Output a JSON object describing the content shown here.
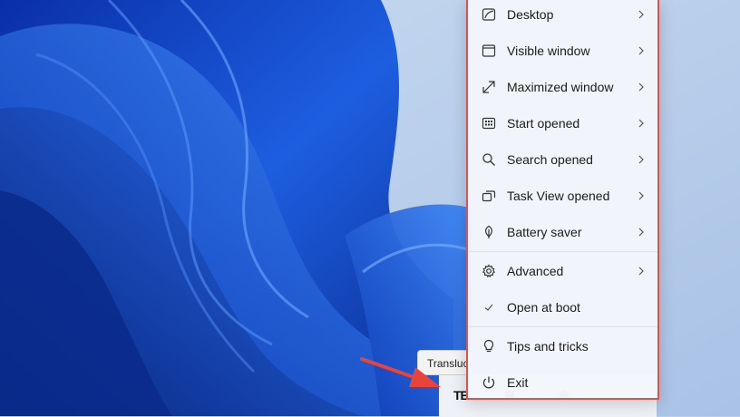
{
  "menu": {
    "items": [
      {
        "label": "Desktop",
        "icon": "desktop-icon",
        "submenu": true
      },
      {
        "label": "Visible window",
        "icon": "window-icon",
        "submenu": true
      },
      {
        "label": "Maximized window",
        "icon": "maximize-icon",
        "submenu": true
      },
      {
        "label": "Start opened",
        "icon": "start-menu-icon",
        "submenu": true
      },
      {
        "label": "Search opened",
        "icon": "search-icon",
        "submenu": true
      },
      {
        "label": "Task View opened",
        "icon": "task-view-icon",
        "submenu": true
      },
      {
        "label": "Battery saver",
        "icon": "leaf-icon",
        "submenu": true
      },
      {
        "label": "Advanced",
        "icon": "gear-icon",
        "submenu": true
      },
      {
        "label": "Open at boot",
        "icon": "checkmark-icon",
        "submenu": false
      },
      {
        "label": "Tips and tricks",
        "icon": "lightbulb-icon",
        "submenu": false
      },
      {
        "label": "Exit",
        "icon": "power-icon",
        "submenu": false
      }
    ]
  },
  "tooltip": {
    "text": "Translucent"
  },
  "taskbar": {
    "app_logo": "TB"
  },
  "colors": {
    "highlight_border": "#e2504a",
    "annotation_arrow": "#e8443a",
    "menu_background": "#f3f6fb",
    "wallpaper_blue": "#1f5bd6"
  }
}
